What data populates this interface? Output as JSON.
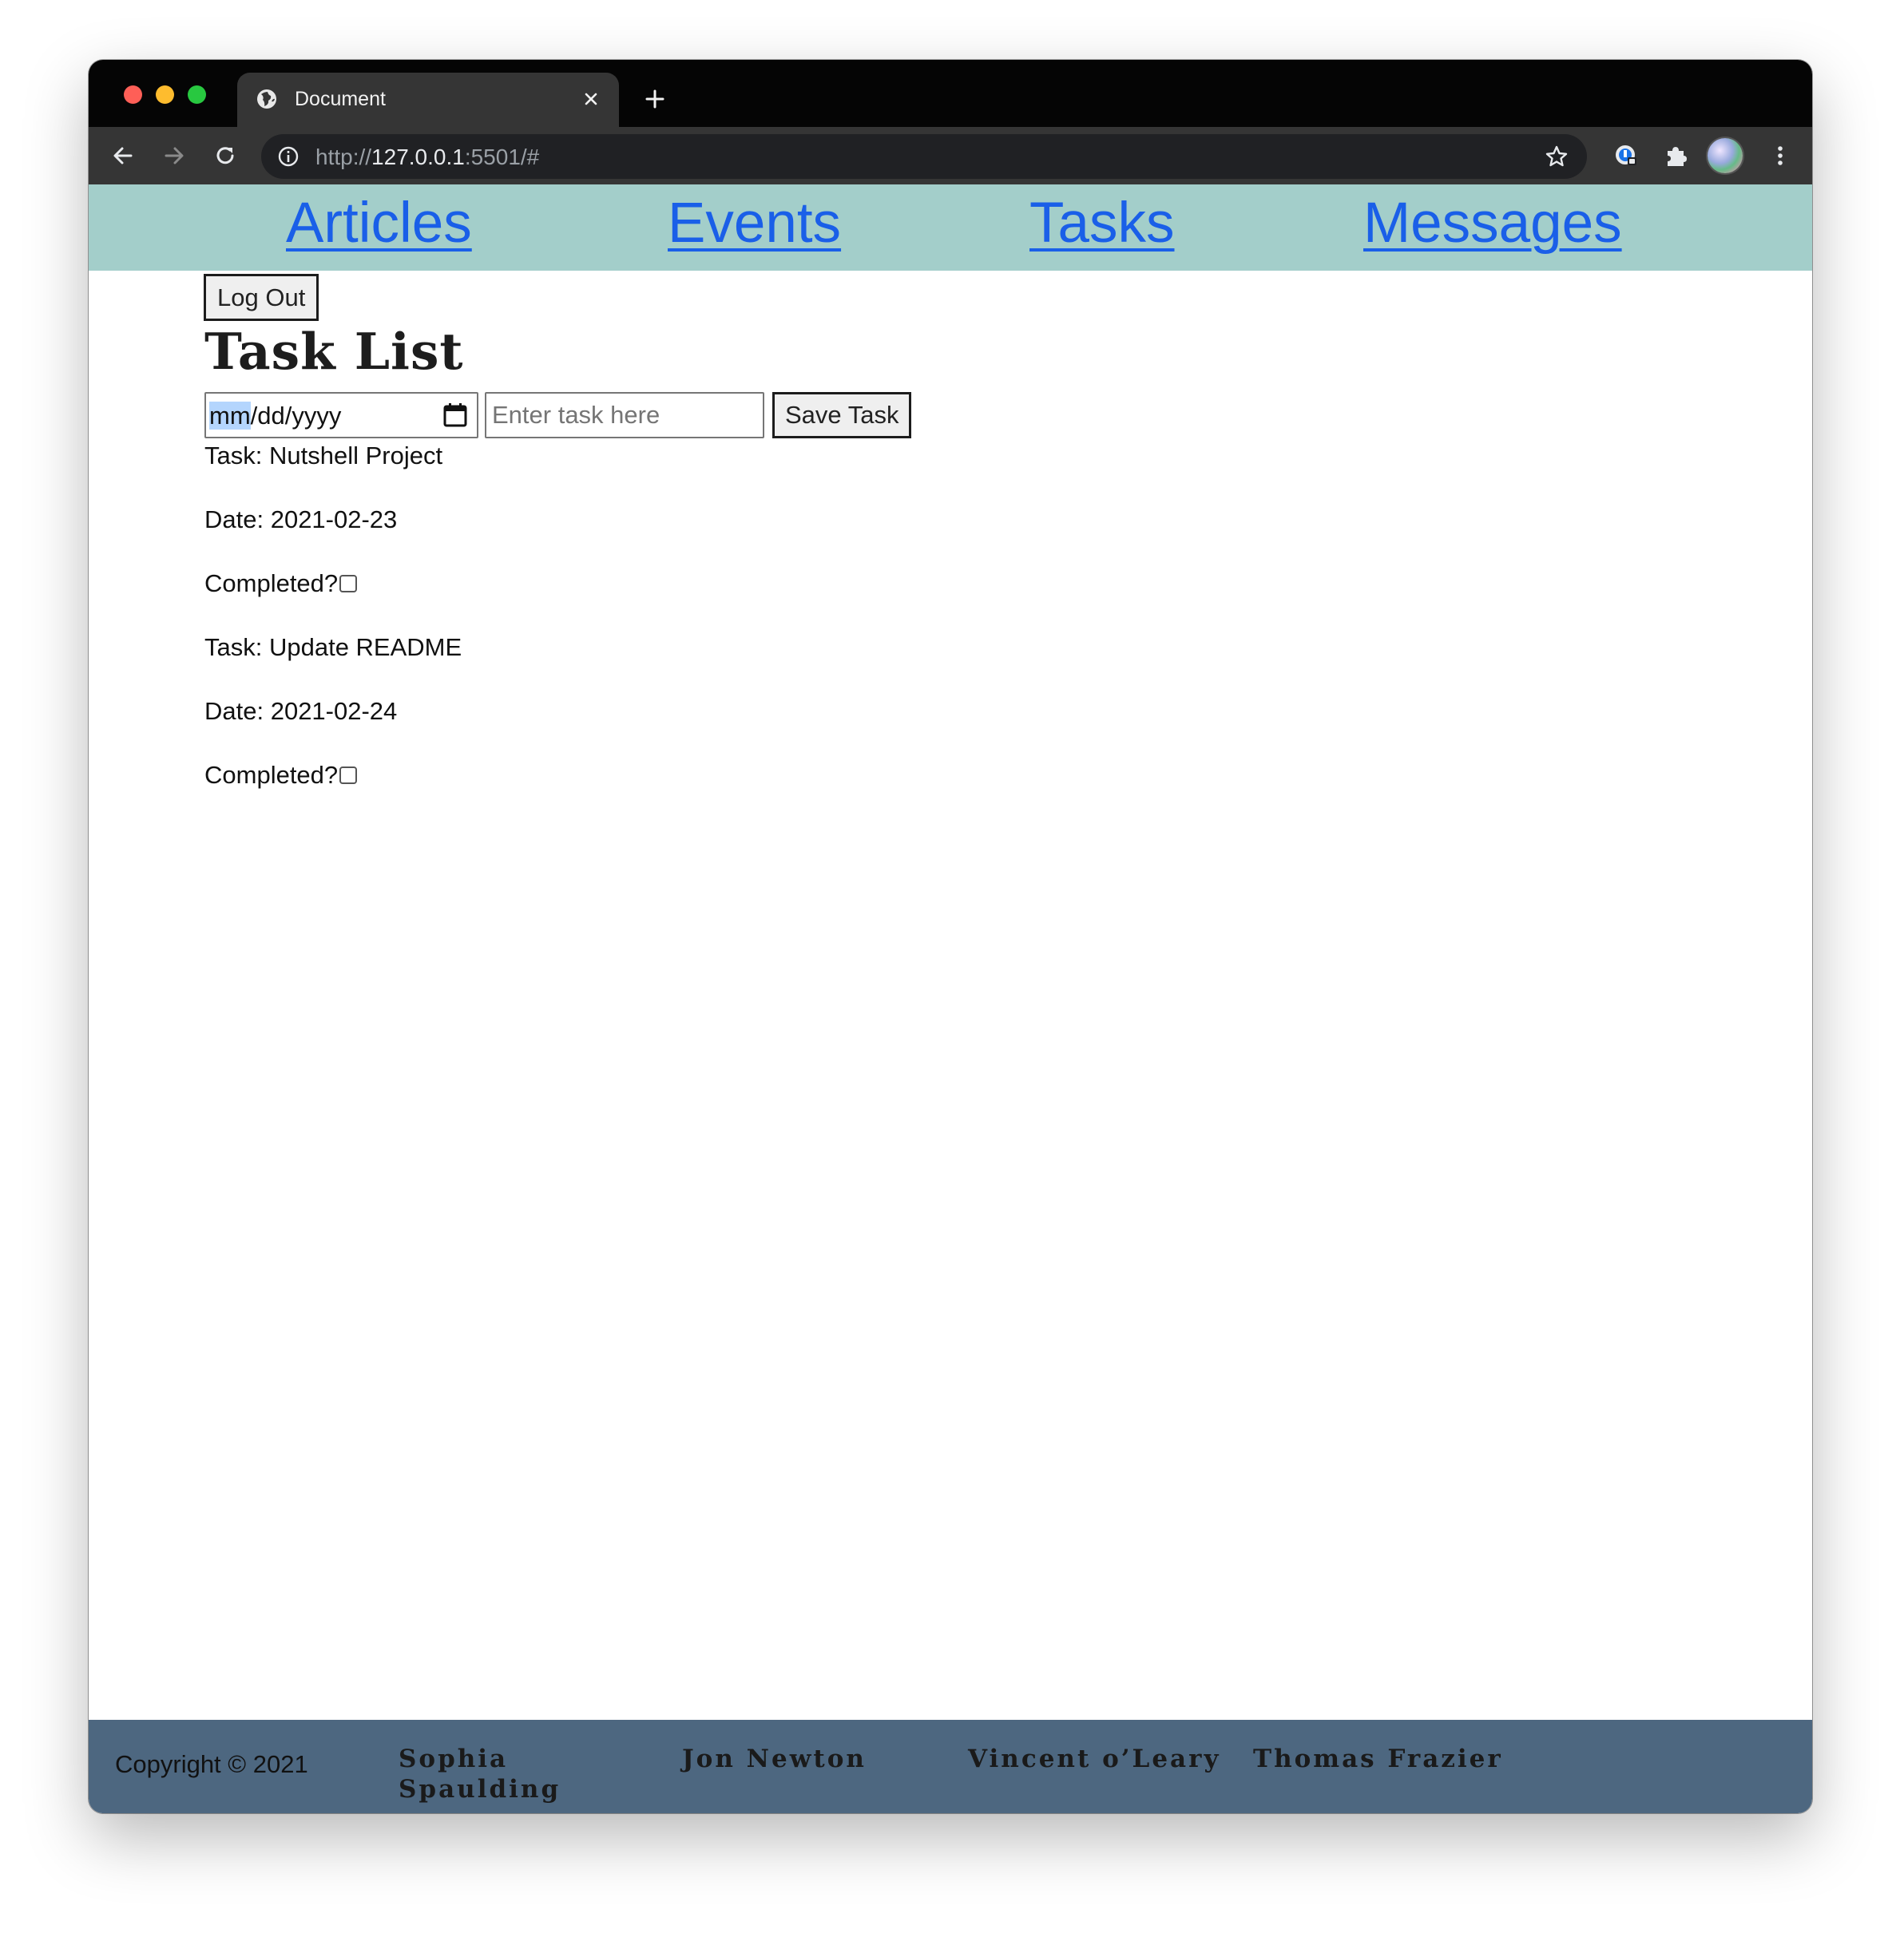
{
  "browser": {
    "tab_title": "Document",
    "url_scheme": "http://",
    "url_host": "127.0.0.1",
    "url_rest": ":5501/#"
  },
  "nav": {
    "items": [
      {
        "label": "Articles"
      },
      {
        "label": "Events"
      },
      {
        "label": "Tasks"
      },
      {
        "label": "Messages"
      }
    ]
  },
  "auth": {
    "logout_label": "Log Out"
  },
  "main": {
    "title": "Task List",
    "date_input": {
      "placeholder_month": "mm",
      "placeholder_rest": "/dd/yyyy"
    },
    "task_input_placeholder": "Enter task here",
    "save_label": "Save Task",
    "tasks": [
      {
        "task_text": "Task: Nutshell Project",
        "date_text": "Date: 2021-02-23",
        "completed_text": "Completed?",
        "completed": false
      },
      {
        "task_text": "Task: Update README",
        "date_text": "Date: 2021-02-24",
        "completed_text": "Completed?",
        "completed": false
      }
    ]
  },
  "footer": {
    "copyright": "Copyright © 2021",
    "authors": [
      {
        "line1": "Sophia",
        "line2": "Spaulding"
      },
      {
        "line1": "Jon Newton",
        "line2": ""
      },
      {
        "line1": "Vincent o’Leary",
        "line2": ""
      },
      {
        "line1": "Thomas Frazier",
        "line2": ""
      }
    ]
  },
  "colors": {
    "nav_background": "#a3ceca",
    "link": "#1a5fe8",
    "footer_background": "#4d6780"
  }
}
